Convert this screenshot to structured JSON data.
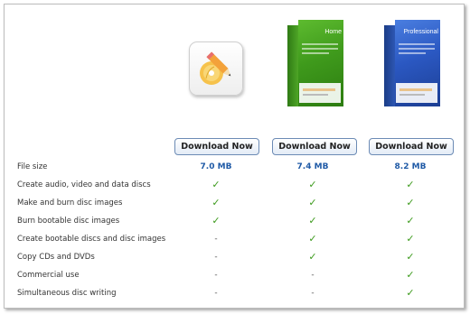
{
  "products": [
    {
      "key": "free",
      "download_label": "Download Now",
      "file_size": "7.0 MB"
    },
    {
      "key": "home",
      "edition": "Home",
      "download_label": "Download Now",
      "file_size": "7.4 MB"
    },
    {
      "key": "pro",
      "edition": "Professional",
      "download_label": "Download Now",
      "file_size": "8.2 MB"
    }
  ],
  "file_size_label": "File size",
  "symbols": {
    "check": "✓",
    "dash": "-"
  },
  "features": [
    {
      "label": "Create audio, video and data discs",
      "free": "✓",
      "home": "✓",
      "pro": "✓"
    },
    {
      "label": "Make and burn disc images",
      "free": "✓",
      "home": "✓",
      "pro": "✓"
    },
    {
      "label": "Burn bootable disc images",
      "free": "✓",
      "home": "✓",
      "pro": "✓"
    },
    {
      "label": "Create bootable discs and disc images",
      "free": "-",
      "home": "✓",
      "pro": "✓"
    },
    {
      "label": "Copy CDs and DVDs",
      "free": "-",
      "home": "✓",
      "pro": "✓"
    },
    {
      "label": "Commercial use",
      "free": "-",
      "home": "-",
      "pro": "✓"
    },
    {
      "label": "Simultaneous disc writing",
      "free": "-",
      "home": "-",
      "pro": "✓"
    }
  ],
  "colors": {
    "check": "#3c9a1c",
    "size": "#1f5aa6",
    "home_box": "#3f9a1c",
    "pro_box": "#2b58c2"
  }
}
